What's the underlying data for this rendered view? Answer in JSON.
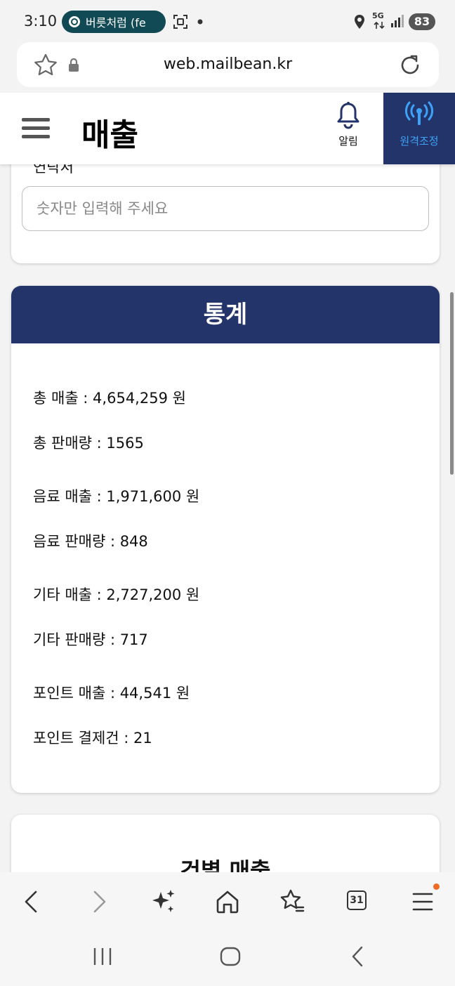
{
  "status": {
    "time": "3:10",
    "notification_pill": "버릇처럼 (fe",
    "network": "5G",
    "battery": "83"
  },
  "browser": {
    "url": "web.mailbean.kr",
    "tabs_count": "31"
  },
  "header": {
    "title": "매출",
    "alarm_label": "알림",
    "remote_label": "원격조정"
  },
  "filter": {
    "field_label": "연락처",
    "placeholder": "숫자만 입력해 주세요"
  },
  "stats": {
    "title": "통계",
    "items": [
      "총 매출 : 4,654,259 원",
      "총 판매량 : 1565",
      "음료 매출 : 1,971,600 원",
      "음료 판매량 : 848",
      "기타 매출 : 2,727,200 원",
      "기타 판매량 : 717",
      "포인트 매출 : 44,541 원",
      "포인트 결제건 : 21"
    ]
  },
  "section3": {
    "title": "건별 매출"
  },
  "colors": {
    "navy": "#23346b",
    "accent_blue": "#3ea2f7",
    "badge_orange": "#f06a24"
  }
}
